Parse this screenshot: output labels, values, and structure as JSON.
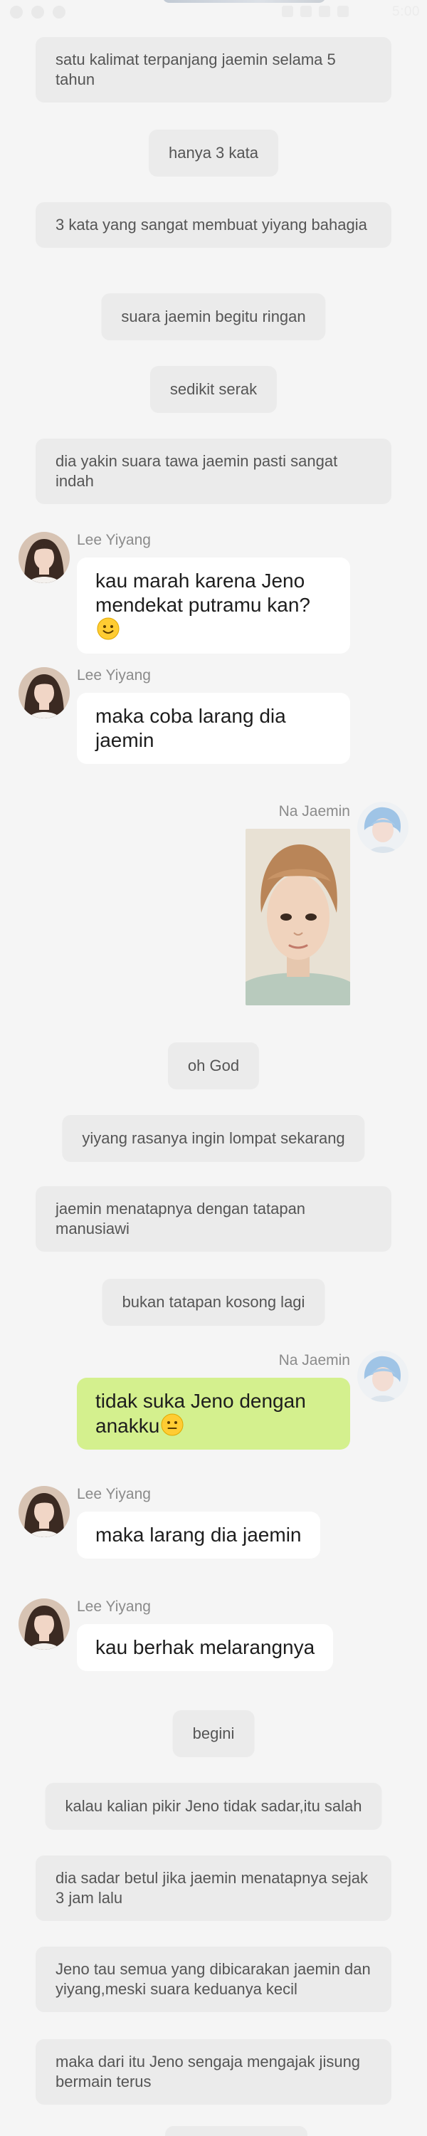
{
  "status_bar": {
    "time": "5:00"
  },
  "narrations": [
    "satu kalimat terpanjang jaemin selama 5 tahun",
    "hanya 3 kata",
    "3 kata yang sangat membuat yiyang bahagia",
    "suara jaemin begitu ringan",
    "sedikit serak",
    "dia yakin suara tawa jaemin pasti sangat indah",
    "oh God",
    "yiyang rasanya ingin lompat sekarang",
    "jaemin menatapnya dengan tatapan manusiawi",
    "bukan tatapan kosong lagi",
    "begini",
    "kalau kalian pikir Jeno tidak sadar,itu salah",
    "dia sadar betul jika jaemin menatapnya sejak 3 jam lalu",
    "Jeno tau semua yang dibicarakan jaemin dan yiyang,meski suara keduanya kecil",
    "maka dari itu Jeno sengaja mengajak jisung bermain terus"
  ],
  "messages": [
    {
      "sender": "Lee Yiyang",
      "text": "kau marah karena Jeno mendekat putramu kan?",
      "emoji": "slightly-smiling-face"
    },
    {
      "sender": "Lee Yiyang",
      "text": "maka coba larang dia jaemin"
    },
    {
      "sender": "Na Jaemin",
      "type": "photo"
    },
    {
      "sender": "Na Jaemin",
      "text": "tidak suka Jeno dengan anakku",
      "emoji": "neutral-face"
    },
    {
      "sender": "Lee Yiyang",
      "text": "maka larang dia jaemin"
    },
    {
      "sender": "Lee Yiyang",
      "text": "kau berhak melarangnya"
    }
  ],
  "colors": {
    "background": "#f5f5f5",
    "narration_bg": "#ebebeb",
    "incoming_bubble": "#ffffff",
    "outgoing_bubble": "#d4f08e"
  },
  "icons": {
    "emoji_smile": "slightly-smiling-face",
    "emoji_neutral": "neutral-face"
  }
}
